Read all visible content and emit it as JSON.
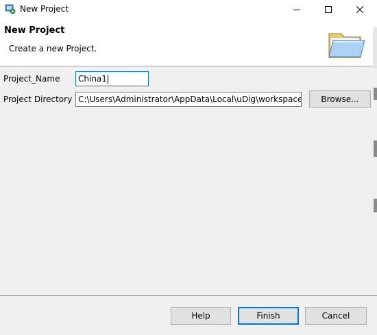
{
  "window": {
    "title": "New Project",
    "controls": {
      "minimize": "minimize-icon",
      "maximize": "maximize-icon",
      "close": "close-icon"
    }
  },
  "banner": {
    "title": "New Project",
    "description": "Create a new Project.",
    "icon": "folder-open-icon"
  },
  "form": {
    "project_name_label": "Project_Name",
    "project_name_value": "China1",
    "project_directory_label": "Project Directory",
    "project_directory_value": "C:\\Users\\Administrator\\AppData\\Local\\uDig\\workspace",
    "browse_label": "Browse..."
  },
  "footer": {
    "help_label": "Help",
    "finish_label": "Finish",
    "cancel_label": "Cancel"
  },
  "colors": {
    "focus_border": "#0078d7",
    "button_bg": "#e1e1e1",
    "dialog_bg": "#f0f0f0"
  }
}
